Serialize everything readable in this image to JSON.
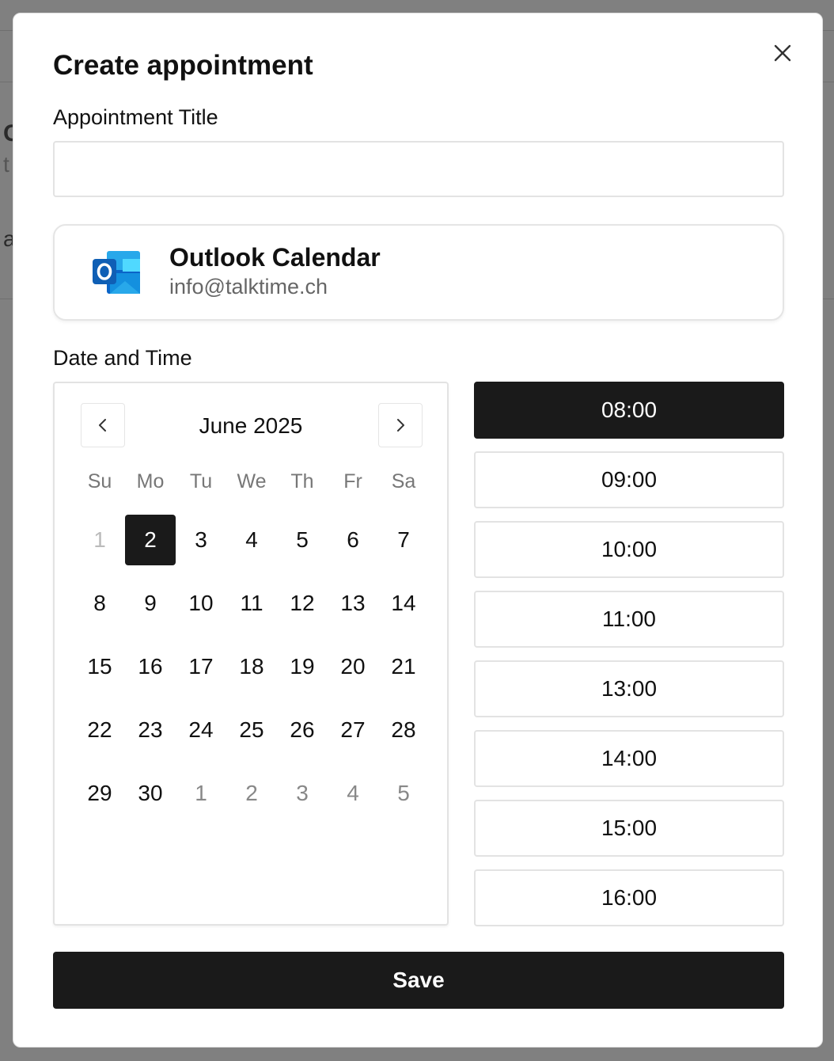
{
  "background": {
    "chars": [
      "C",
      "t",
      "a"
    ]
  },
  "modal": {
    "title": "Create appointment",
    "title_label": "Appointment Title",
    "title_value": "",
    "title_placeholder": "",
    "calendar_account": {
      "name": "Outlook Calendar",
      "email": "info@talktime.ch",
      "icon": "outlook-icon"
    },
    "date_time_label": "Date and Time",
    "calendar": {
      "month_label": "June 2025",
      "weekdays": [
        "Su",
        "Mo",
        "Tu",
        "We",
        "Th",
        "Fr",
        "Sa"
      ],
      "days": [
        {
          "label": "1",
          "state": "faded"
        },
        {
          "label": "2",
          "state": "selected"
        },
        {
          "label": "3",
          "state": ""
        },
        {
          "label": "4",
          "state": ""
        },
        {
          "label": "5",
          "state": ""
        },
        {
          "label": "6",
          "state": ""
        },
        {
          "label": "7",
          "state": ""
        },
        {
          "label": "8",
          "state": ""
        },
        {
          "label": "9",
          "state": ""
        },
        {
          "label": "10",
          "state": ""
        },
        {
          "label": "11",
          "state": ""
        },
        {
          "label": "12",
          "state": ""
        },
        {
          "label": "13",
          "state": ""
        },
        {
          "label": "14",
          "state": ""
        },
        {
          "label": "15",
          "state": ""
        },
        {
          "label": "16",
          "state": ""
        },
        {
          "label": "17",
          "state": ""
        },
        {
          "label": "18",
          "state": ""
        },
        {
          "label": "19",
          "state": ""
        },
        {
          "label": "20",
          "state": ""
        },
        {
          "label": "21",
          "state": ""
        },
        {
          "label": "22",
          "state": ""
        },
        {
          "label": "23",
          "state": ""
        },
        {
          "label": "24",
          "state": ""
        },
        {
          "label": "25",
          "state": ""
        },
        {
          "label": "26",
          "state": ""
        },
        {
          "label": "27",
          "state": ""
        },
        {
          "label": "28",
          "state": ""
        },
        {
          "label": "29",
          "state": ""
        },
        {
          "label": "30",
          "state": ""
        },
        {
          "label": "1",
          "state": "muted"
        },
        {
          "label": "2",
          "state": "muted"
        },
        {
          "label": "3",
          "state": "muted"
        },
        {
          "label": "4",
          "state": "muted"
        },
        {
          "label": "5",
          "state": "muted"
        }
      ]
    },
    "time_slots": [
      {
        "label": "08:00",
        "active": true
      },
      {
        "label": "09:00",
        "active": false
      },
      {
        "label": "10:00",
        "active": false
      },
      {
        "label": "11:00",
        "active": false
      },
      {
        "label": "13:00",
        "active": false
      },
      {
        "label": "14:00",
        "active": false
      },
      {
        "label": "15:00",
        "active": false
      },
      {
        "label": "16:00",
        "active": false
      }
    ],
    "save_label": "Save"
  },
  "colors": {
    "primary": "#1a1a1a",
    "outlook_blue": "#0a64c8",
    "muted_text": "#666666"
  }
}
